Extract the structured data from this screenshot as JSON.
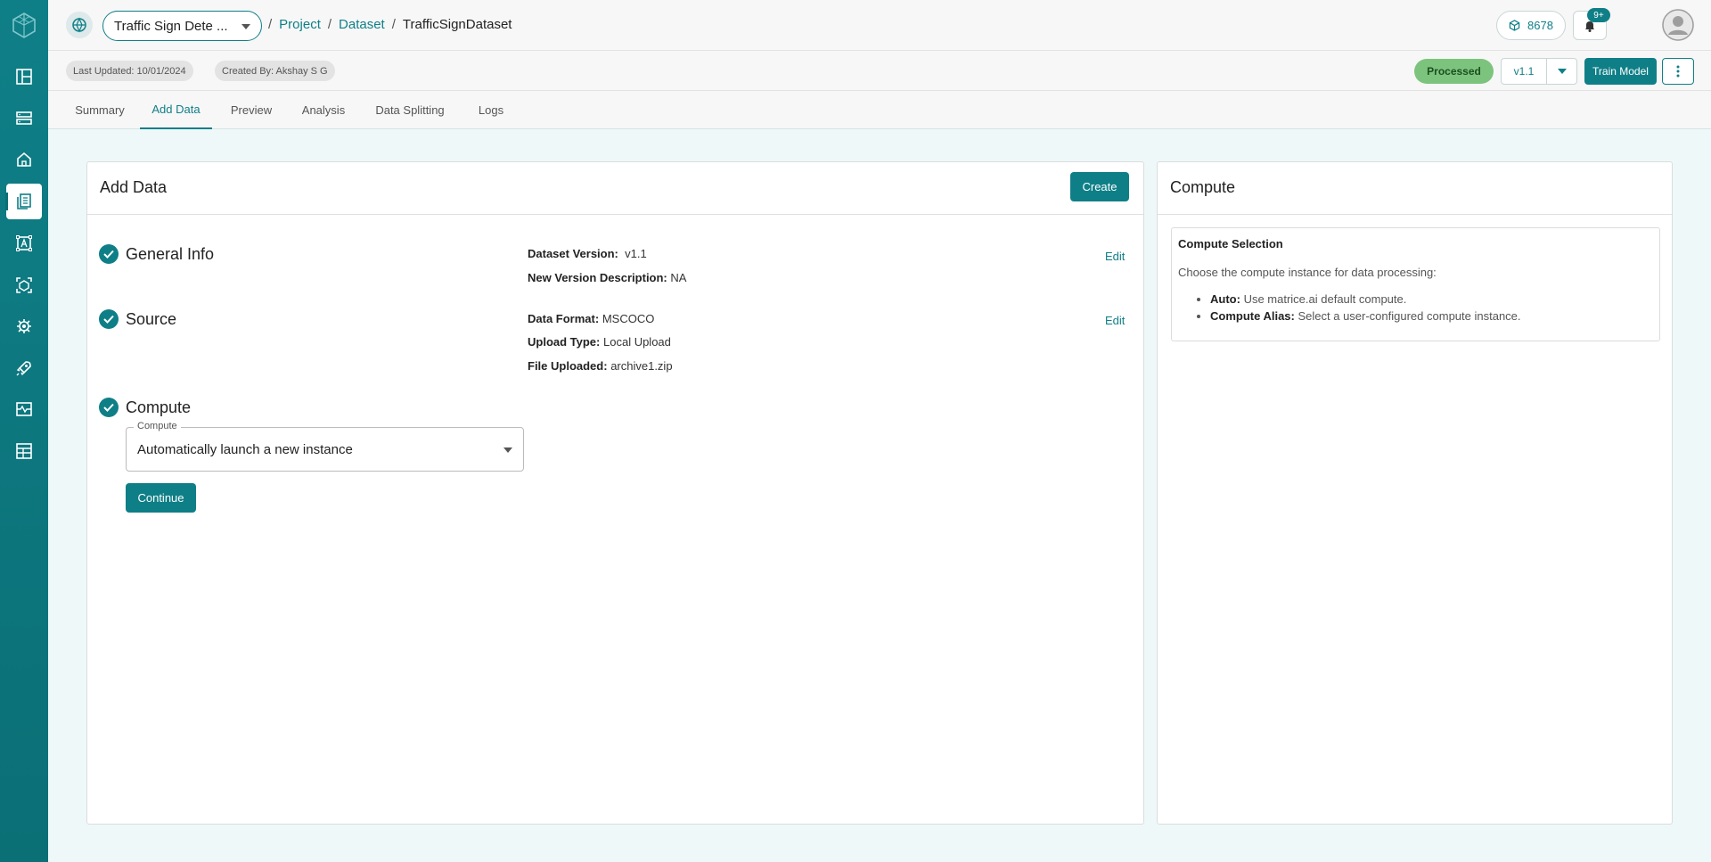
{
  "app": {
    "logo": "app-logo-cube-icon"
  },
  "sidebar": {
    "items": [
      {
        "name": "dashboard-icon"
      },
      {
        "name": "storage-icon"
      },
      {
        "name": "home-icon"
      },
      {
        "name": "datasets-icon",
        "active": true
      },
      {
        "name": "annotation-icon"
      },
      {
        "name": "models-icon"
      },
      {
        "name": "settings-chip-icon"
      },
      {
        "name": "deploy-rocket-icon"
      },
      {
        "name": "monitoring-icon"
      },
      {
        "name": "reports-icon"
      }
    ]
  },
  "header": {
    "project_select": "Traffic Sign Dete ...",
    "breadcrumb": {
      "project": "Project",
      "dataset": "Dataset",
      "current": "TrafficSignDataset",
      "sep": "/"
    },
    "credits": "8678",
    "notifications_badge": "9+"
  },
  "meta": {
    "last_updated": "Last Updated: 10/01/2024",
    "created_by": "Created By: Akshay S G",
    "status": "Processed",
    "version": "v1.1",
    "train_model": "Train Model"
  },
  "tabs": [
    "Summary",
    "Add Data",
    "Preview",
    "Analysis",
    "Data Splitting",
    "Logs"
  ],
  "active_tab": "Add Data",
  "add_data": {
    "title": "Add Data",
    "create_label": "Create",
    "general_info": {
      "title": "General Info",
      "version_label": "Dataset Version:",
      "version_value": "v1.1",
      "desc_label": "New Version Description:",
      "desc_value": "NA",
      "edit": "Edit"
    },
    "source": {
      "title": "Source",
      "format_label": "Data Format:",
      "format_value": "MSCOCO",
      "upload_label": "Upload Type:",
      "upload_value": "Local Upload",
      "file_label": "File Uploaded:",
      "file_value": "archive1.zip",
      "edit": "Edit"
    },
    "compute": {
      "title": "Compute",
      "field_label": "Compute",
      "field_value": "Automatically launch a new instance",
      "continue_label": "Continue"
    }
  },
  "compute_panel": {
    "title": "Compute",
    "box_title": "Compute Selection",
    "description": "Choose the compute instance for data processing:",
    "options": [
      {
        "label": "Auto:",
        "text": "Use matrice.ai default compute."
      },
      {
        "label": "Compute Alias:",
        "text": "Select a user-configured compute instance."
      }
    ]
  },
  "colors": {
    "primary": "#0f7f87",
    "status_green": "#7cc47e",
    "background": "#eef8f9"
  }
}
